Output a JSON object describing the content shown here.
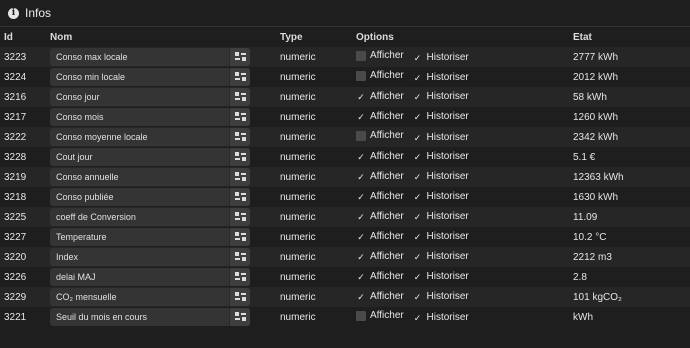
{
  "header": {
    "title": "Infos",
    "icon": "info-icon"
  },
  "columns": {
    "id": "Id",
    "name": "Nom",
    "type": "Type",
    "options": "Options",
    "state": "Etat"
  },
  "option_labels": {
    "show": "Afficher",
    "history": "Historiser"
  },
  "rows": [
    {
      "id": "3223",
      "name": "Conso max locale",
      "type": "numeric",
      "show": false,
      "history": true,
      "state": "2777 kWh"
    },
    {
      "id": "3224",
      "name": "Conso min locale",
      "type": "numeric",
      "show": false,
      "history": true,
      "state": "2012 kWh"
    },
    {
      "id": "3216",
      "name": "Conso jour",
      "type": "numeric",
      "show": true,
      "history": true,
      "state": "58 kWh"
    },
    {
      "id": "3217",
      "name": "Conso mois",
      "type": "numeric",
      "show": true,
      "history": true,
      "state": "1260 kWh"
    },
    {
      "id": "3222",
      "name": "Conso moyenne locale",
      "type": "numeric",
      "show": false,
      "history": true,
      "state": "2342 kWh"
    },
    {
      "id": "3228",
      "name": "Cout jour",
      "type": "numeric",
      "show": true,
      "history": true,
      "state": "5.1 €"
    },
    {
      "id": "3219",
      "name": "Conso annuelle",
      "type": "numeric",
      "show": true,
      "history": true,
      "state": "12363 kWh"
    },
    {
      "id": "3218",
      "name": "Conso publiée",
      "type": "numeric",
      "show": true,
      "history": true,
      "state": "1630 kWh"
    },
    {
      "id": "3225",
      "name": "coeff de Conversion",
      "type": "numeric",
      "show": true,
      "history": true,
      "state": "11.09"
    },
    {
      "id": "3227",
      "name": "Temperature",
      "type": "numeric",
      "show": true,
      "history": true,
      "state": "10.2 °C"
    },
    {
      "id": "3220",
      "name": "Index",
      "type": "numeric",
      "show": true,
      "history": true,
      "state": "2212 m3"
    },
    {
      "id": "3226",
      "name": "delai MAJ",
      "type": "numeric",
      "show": true,
      "history": true,
      "state": "2.8"
    },
    {
      "id": "3229",
      "name": "CO₂ mensuelle",
      "type": "numeric",
      "show": true,
      "history": true,
      "state": "101 kgCO₂"
    },
    {
      "id": "3221",
      "name": "Seuil du mois en cours",
      "type": "numeric",
      "show": false,
      "history": true,
      "state": "kWh"
    }
  ]
}
